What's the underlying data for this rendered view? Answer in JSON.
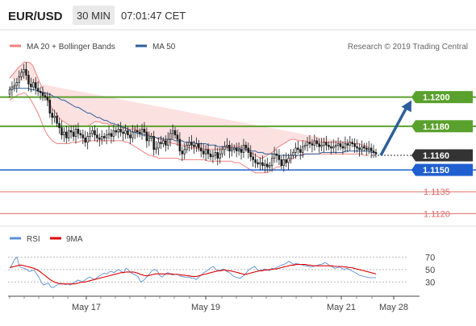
{
  "header": {
    "symbol": "EUR/USD",
    "timeframe": "30 MIN",
    "time": "07:01:47 CET"
  },
  "legend": {
    "bollinger_label": "MA 20 + Bollinger Bands",
    "ma50_label": "MA 50",
    "source": "Research © 2019 Trading Central"
  },
  "rsi_legend": {
    "rsi_label": "RSI",
    "ma9_label": "9MA"
  },
  "colors": {
    "candle": "#1a1a1a",
    "bollinger": "#f08080",
    "bollinger_fill": "#f9c9c9",
    "ma50": "#2e5f9a",
    "resistance": "#5aa02c",
    "support_blue": "#1f5fd0",
    "support_red": "#e06a6a",
    "current": "#333333",
    "arrow": "#2e5f9a",
    "rsi": "#5b8fd9",
    "ma9": "#e00000"
  },
  "chart_data": [
    {
      "type": "candlestick",
      "title": "EUR/USD 30 MIN",
      "ylim": [
        1.1113,
        1.1228
      ],
      "x_tick_labels": [
        "May 17",
        "May 19",
        "May 21",
        "May 28"
      ],
      "series_names": [
        "MA 20 + Bollinger Bands",
        "MA 50"
      ],
      "ohlc_close": [
        1.1205,
        1.1207,
        1.1208,
        1.121,
        1.1214,
        1.1217,
        1.1219,
        1.1215,
        1.1209,
        1.1207,
        1.121,
        1.1206,
        1.1204,
        1.1203,
        1.1201,
        1.12,
        1.1198,
        1.1189,
        1.1186,
        1.1187,
        1.1182,
        1.1179,
        1.1174,
        1.1176,
        1.1172,
        1.1177,
        1.1176,
        1.1173,
        1.1178,
        1.1175,
        1.1174,
        1.1172,
        1.1169,
        1.1173,
        1.1175,
        1.1177,
        1.1174,
        1.1172,
        1.1171,
        1.1173,
        1.1172,
        1.1174,
        1.1175,
        1.1173,
        1.1177,
        1.1176,
        1.1178,
        1.1176,
        1.1175,
        1.1177,
        1.1174,
        1.1172,
        1.1176,
        1.1177,
        1.1176,
        1.1175,
        1.1178,
        1.1176,
        1.117,
        1.1172,
        1.1173,
        1.1164,
        1.1165,
        1.1169,
        1.1168,
        1.117,
        1.1167,
        1.1171,
        1.1175,
        1.1177,
        1.1174,
        1.1171,
        1.1163,
        1.1161,
        1.1164,
        1.1167,
        1.1169,
        1.1167,
        1.1166,
        1.1168,
        1.1165,
        1.1163,
        1.1161,
        1.1164,
        1.1161,
        1.1159,
        1.116,
        1.1162,
        1.1158,
        1.1161,
        1.1164,
        1.1166,
        1.1167,
        1.1163,
        1.1164,
        1.1165,
        1.1163,
        1.1164,
        1.1162,
        1.1167,
        1.1165,
        1.1162,
        1.1159,
        1.1157,
        1.1155,
        1.1154,
        1.1155,
        1.1153,
        1.1154,
        1.1152,
        1.1153,
        1.1158,
        1.1161,
        1.116,
        1.1157,
        1.1153,
        1.1157,
        1.1155,
        1.1158,
        1.116,
        1.1162,
        1.1165,
        1.1164,
        1.1162,
        1.1166,
        1.1167,
        1.1169,
        1.1168,
        1.1167,
        1.117,
        1.1168,
        1.1166,
        1.1167,
        1.1169,
        1.1167,
        1.1166,
        1.1165,
        1.1166,
        1.1167,
        1.1168,
        1.1166,
        1.1165,
        1.1168,
        1.1167,
        1.1169,
        1.1168,
        1.1166,
        1.1165,
        1.1164,
        1.1166,
        1.1165,
        1.1164,
        1.1165,
        1.1163,
        1.1162,
        1.1161
      ],
      "bollinger_upper": [
        1.1213,
        1.1215,
        1.1217,
        1.1219,
        1.1221,
        1.1222,
        1.1224,
        1.1224,
        1.1224,
        1.1223,
        1.1221,
        1.1217,
        1.1213,
        1.1209,
        1.1205,
        1.1201,
        1.1198,
        1.1195,
        1.1192,
        1.119,
        1.1188,
        1.1186,
        1.1184,
        1.1183,
        1.1182,
        1.1181,
        1.118,
        1.118,
        1.118,
        1.118,
        1.118,
        1.118,
        1.118,
        1.118,
        1.1181,
        1.1182,
        1.1183,
        1.1183,
        1.1183,
        1.1182,
        1.1182,
        1.1182,
        1.1181,
        1.1181,
        1.118,
        1.118,
        1.118,
        1.1179,
        1.1179,
        1.1178,
        1.1178,
        1.1178,
        1.1178,
        1.1178,
        1.1177,
        1.1177,
        1.1177,
        1.1176,
        1.1175,
        1.1174,
        1.1173,
        1.1173,
        1.1172,
        1.1171,
        1.1171,
        1.117,
        1.117,
        1.1169,
        1.1169,
        1.1168,
        1.1168,
        1.1167,
        1.1167,
        1.1167,
        1.1166,
        1.1166,
        1.1165,
        1.1165,
        1.1165,
        1.1165,
        1.1164,
        1.1164,
        1.1164,
        1.1164,
        1.1164,
        1.1164,
        1.1164,
        1.1164,
        1.1164,
        1.1164,
        1.1165,
        1.1165,
        1.1165,
        1.1166,
        1.1166,
        1.1166,
        1.1166,
        1.1166,
        1.1165,
        1.1165,
        1.1164,
        1.1163,
        1.1162,
        1.1161,
        1.116,
        1.1159,
        1.1158,
        1.1158,
        1.1159,
        1.116,
        1.1161,
        1.1162,
        1.1163,
        1.1165,
        1.1166,
        1.1167,
        1.1168,
        1.1169,
        1.117,
        1.1171,
        1.1171,
        1.1171,
        1.117,
        1.117,
        1.117,
        1.117,
        1.1169,
        1.1169,
        1.1169,
        1.1169,
        1.1169,
        1.1169,
        1.1169,
        1.1169,
        1.1169,
        1.1169,
        1.1169,
        1.1169,
        1.1169,
        1.1169,
        1.1169,
        1.1169,
        1.1169,
        1.1169,
        1.1169,
        1.1168,
        1.1168,
        1.1168,
        1.1168,
        1.1167,
        1.1167,
        1.1166,
        1.1166
      ],
      "bollinger_lower": [
        1.1198,
        1.1199,
        1.12,
        1.1201,
        1.1202,
        1.1202,
        1.1203,
        1.1202,
        1.12,
        1.1198,
        1.1195,
        1.1192,
        1.1189,
        1.1185,
        1.1181,
        1.1177,
        1.1174,
        1.1172,
        1.117,
        1.1169,
        1.1168,
        1.1168,
        1.1168,
        1.1168,
        1.1168,
        1.1168,
        1.1169,
        1.1169,
        1.1169,
        1.1169,
        1.117,
        1.117,
        1.117,
        1.117,
        1.117,
        1.117,
        1.117,
        1.117,
        1.117,
        1.117,
        1.117,
        1.117,
        1.117,
        1.117,
        1.117,
        1.117,
        1.117,
        1.117,
        1.117,
        1.1169,
        1.1169,
        1.1168,
        1.1167,
        1.1166,
        1.1165,
        1.1164,
        1.1163,
        1.1162,
        1.1161,
        1.116,
        1.116,
        1.1159,
        1.1159,
        1.1158,
        1.1158,
        1.1158,
        1.1158,
        1.1158,
        1.1158,
        1.1158,
        1.1158,
        1.1158,
        1.1157,
        1.1157,
        1.1157,
        1.1157,
        1.1157,
        1.1157,
        1.1157,
        1.1157,
        1.1157,
        1.1157,
        1.1157,
        1.1157,
        1.1156,
        1.1156,
        1.1156,
        1.1156,
        1.1156,
        1.1156,
        1.1156,
        1.1156,
        1.1156,
        1.1156,
        1.1156,
        1.1155,
        1.1155,
        1.1155,
        1.1154,
        1.1153,
        1.1152,
        1.1151,
        1.115,
        1.1149,
        1.1148,
        1.1148,
        1.1148,
        1.1148,
        1.1148,
        1.1148,
        1.1149,
        1.115,
        1.1151,
        1.1152,
        1.1152,
        1.1153,
        1.1154,
        1.1155,
        1.1156,
        1.1157,
        1.1158,
        1.1159,
        1.116,
        1.116,
        1.1161,
        1.1161,
        1.1161,
        1.1161,
        1.1161,
        1.1161,
        1.1161,
        1.1161,
        1.1161,
        1.1161,
        1.1161,
        1.1161,
        1.1161,
        1.1161,
        1.1161,
        1.1161,
        1.1161,
        1.1161,
        1.1161,
        1.1161,
        1.1161,
        1.1161,
        1.1161,
        1.1161,
        1.1161,
        1.1161,
        1.116,
        1.116,
        1.116
      ],
      "ma50": [
        1.1206,
        1.1206,
        1.1206,
        1.1206,
        1.1206,
        1.1206,
        1.1206,
        1.1206,
        1.1206,
        1.1205,
        1.1205,
        1.1205,
        1.1204,
        1.1204,
        1.1203,
        1.1203,
        1.1202,
        1.1202,
        1.1201,
        1.12,
        1.12,
        1.1199,
        1.1198,
        1.1198,
        1.1197,
        1.1196,
        1.1195,
        1.1194,
        1.1193,
        1.1193,
        1.1192,
        1.1191,
        1.119,
        1.1189,
        1.1189,
        1.1188,
        1.1187,
        1.1186,
        1.1186,
        1.1185,
        1.1184,
        1.1184,
        1.1183,
        1.1182,
        1.1182,
        1.1181,
        1.1181,
        1.118,
        1.1179,
        1.1179,
        1.1178,
        1.1177,
        1.1176,
        1.1176,
        1.1175,
        1.1175,
        1.1174,
        1.1174,
        1.1174,
        1.1173,
        1.1173,
        1.1173,
        1.1172,
        1.1172,
        1.1172,
        1.1171,
        1.1171,
        1.1171,
        1.1171,
        1.1171,
        1.117,
        1.117,
        1.117,
        1.117,
        1.1169,
        1.1169,
        1.1169,
        1.1169,
        1.1169,
        1.1168,
        1.1168,
        1.1168,
        1.1168,
        1.1168,
        1.1167,
        1.1167,
        1.1167,
        1.1167,
        1.1166,
        1.1166,
        1.1166,
        1.1166,
        1.1166,
        1.1165,
        1.1165,
        1.1165,
        1.1165,
        1.1165,
        1.1164,
        1.1164,
        1.1164,
        1.1164,
        1.1163,
        1.1163,
        1.1163,
        1.1162,
        1.1162,
        1.1162,
        1.1161,
        1.1161,
        1.1161,
        1.1161,
        1.1161,
        1.116,
        1.116,
        1.116,
        1.116,
        1.116,
        1.116,
        1.116,
        1.116,
        1.116,
        1.116,
        1.116,
        1.116,
        1.1161,
        1.1161,
        1.1161,
        1.1161,
        1.1161,
        1.1161,
        1.1161,
        1.1162,
        1.1162,
        1.1162,
        1.1162,
        1.1162,
        1.1162,
        1.1162,
        1.1162,
        1.1162,
        1.1162,
        1.1163,
        1.1163,
        1.1163,
        1.1163,
        1.1163,
        1.1163,
        1.1163,
        1.1163,
        1.1163,
        1.1163,
        1.1163,
        1.1162,
        1.1162,
        1.1162
      ],
      "levels": [
        {
          "value": 1.12,
          "label": "1.1200",
          "kind": "resistance"
        },
        {
          "value": 1.118,
          "label": "1.1180",
          "kind": "resistance"
        },
        {
          "value": 1.116,
          "label": "1.1160",
          "kind": "current"
        },
        {
          "value": 1.115,
          "label": "1.1150",
          "kind": "support"
        },
        {
          "value": 1.1135,
          "label": "1.1135",
          "kind": "support-minor"
        },
        {
          "value": 1.112,
          "label": "1.1120",
          "kind": "support-minor"
        }
      ],
      "projection": {
        "from": 1.116,
        "to": 1.12
      }
    },
    {
      "type": "line",
      "title": "RSI",
      "ylim": [
        15,
        82
      ],
      "y_ticks": [
        30,
        50,
        70
      ],
      "series": [
        {
          "name": "RSI",
          "values": [
            52,
            58,
            66,
            70,
            55,
            53,
            52,
            50,
            47,
            48,
            49,
            44,
            38,
            30,
            25,
            27,
            28,
            22,
            21,
            24,
            26,
            28,
            27,
            26,
            27,
            25,
            28,
            30,
            33,
            32,
            30,
            33,
            36,
            38,
            36,
            34,
            37,
            40,
            42,
            44,
            43,
            46,
            47,
            45,
            48,
            50,
            47,
            45,
            52,
            49,
            45,
            43,
            41,
            38,
            30,
            32,
            36,
            40,
            45,
            49,
            50,
            47,
            40,
            38,
            42,
            45,
            44,
            41,
            42,
            43,
            40,
            39,
            38,
            37,
            38,
            36,
            36,
            34,
            38,
            41,
            45,
            47,
            50,
            53,
            55,
            50,
            48,
            49,
            51,
            48,
            46,
            44,
            40,
            38,
            37,
            36,
            39,
            42,
            47,
            51,
            53,
            55,
            50,
            48,
            49,
            51,
            50,
            48,
            52,
            51,
            53,
            55,
            57,
            58,
            60,
            63,
            61,
            58,
            60,
            59,
            58,
            57,
            56,
            55,
            54,
            55,
            56,
            57,
            58,
            59,
            61,
            59,
            56,
            54,
            52,
            53,
            54,
            52,
            50,
            52,
            50,
            48,
            46,
            44,
            41,
            40,
            39,
            38,
            37,
            37,
            37,
            37
          ]
        },
        {
          "name": "9MA",
          "values": [
            53,
            54,
            55,
            56,
            57,
            57,
            56,
            55,
            54,
            53,
            52,
            50,
            48,
            45,
            42,
            39,
            36,
            33,
            31,
            29,
            28,
            27,
            27,
            27,
            27,
            27,
            27,
            27,
            28,
            29,
            30,
            30,
            31,
            32,
            33,
            34,
            35,
            36,
            37,
            38,
            39,
            40,
            41,
            42,
            43,
            44,
            45,
            45,
            46,
            46,
            46,
            46,
            45,
            44,
            42,
            41,
            40,
            40,
            41,
            42,
            43,
            43,
            43,
            43,
            43,
            43,
            43,
            43,
            42,
            42,
            42,
            41,
            41,
            40,
            40,
            39,
            39,
            39,
            40,
            41,
            42,
            43,
            44,
            45,
            46,
            47,
            48,
            48,
            49,
            49,
            48,
            48,
            47,
            46,
            45,
            44,
            43,
            42,
            43,
            44,
            45,
            46,
            47,
            48,
            48,
            49,
            49,
            50,
            50,
            51,
            51,
            52,
            53,
            54,
            55,
            56,
            57,
            57,
            58,
            58,
            58,
            58,
            58,
            57,
            57,
            56,
            56,
            56,
            56,
            56,
            56,
            56,
            56,
            56,
            55,
            55,
            55,
            55,
            54,
            54,
            53,
            53,
            52,
            51,
            50,
            49,
            48,
            47,
            46,
            45,
            44,
            43
          ]
        }
      ]
    }
  ]
}
